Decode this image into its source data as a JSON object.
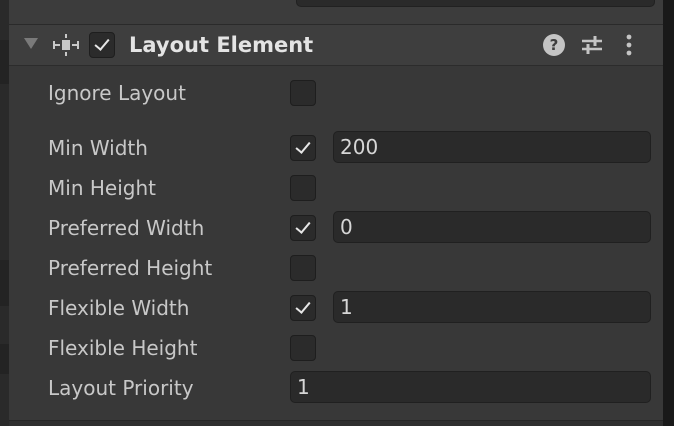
{
  "component": {
    "title": "Layout Element",
    "enabled": true,
    "icons": {
      "foldout": "foldout-arrow-icon",
      "component": "layout-element-icon",
      "help": "help-icon",
      "presets": "presets-icon",
      "menu": "kebab-menu-icon"
    },
    "help_glyph": "?"
  },
  "properties": {
    "ignore_layout": {
      "label": "Ignore Layout",
      "checked": false
    },
    "min_width": {
      "label": "Min Width",
      "checked": true,
      "value": "200"
    },
    "min_height": {
      "label": "Min Height",
      "checked": false
    },
    "preferred_width": {
      "label": "Preferred Width",
      "checked": true,
      "value": "0"
    },
    "preferred_height": {
      "label": "Preferred Height",
      "checked": false
    },
    "flexible_width": {
      "label": "Flexible Width",
      "checked": true,
      "value": "1"
    },
    "flexible_height": {
      "label": "Flexible Height",
      "checked": false
    },
    "layout_priority": {
      "label": "Layout Priority",
      "value": "1"
    }
  },
  "colors": {
    "panel_bg": "#383838",
    "header_bg": "#3e3e3e",
    "field_bg": "#2a2a2a",
    "text": "#c8c8c8",
    "title_text": "#e4e4e4"
  }
}
